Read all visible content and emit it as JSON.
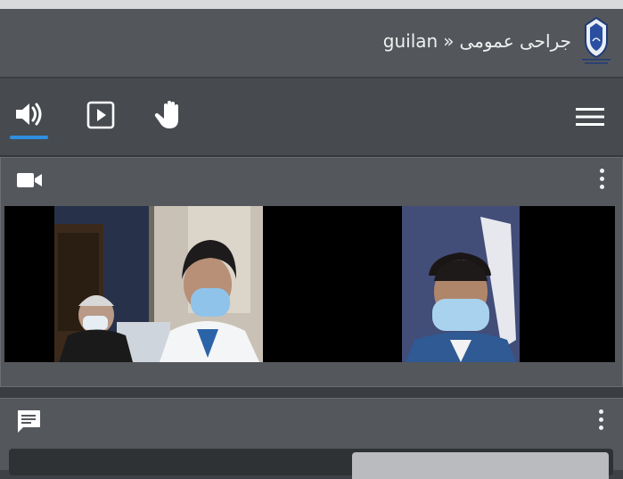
{
  "header": {
    "site": "guilan",
    "separator": "»",
    "room_name": "جراحی عمومی",
    "logo_icon": "university-emblem-icon"
  },
  "toolbar": {
    "items": [
      {
        "icon": "speaker-icon",
        "active": true
      },
      {
        "icon": "play-square-icon",
        "active": false
      },
      {
        "icon": "raise-hand-icon",
        "active": false
      }
    ],
    "menu_icon": "hamburger-menu-icon",
    "active_color": "#2e8fe0"
  },
  "video_panel": {
    "icon": "video-camera-icon",
    "menu_icon": "more-vertical-icon",
    "feeds": [
      {
        "description": "two participants, one in white coat and blue mask"
      },
      {
        "description": "participant in blue mask"
      }
    ]
  },
  "chat_panel": {
    "icon": "chat-bubble-icon",
    "menu_icon": "more-vertical-icon"
  }
}
